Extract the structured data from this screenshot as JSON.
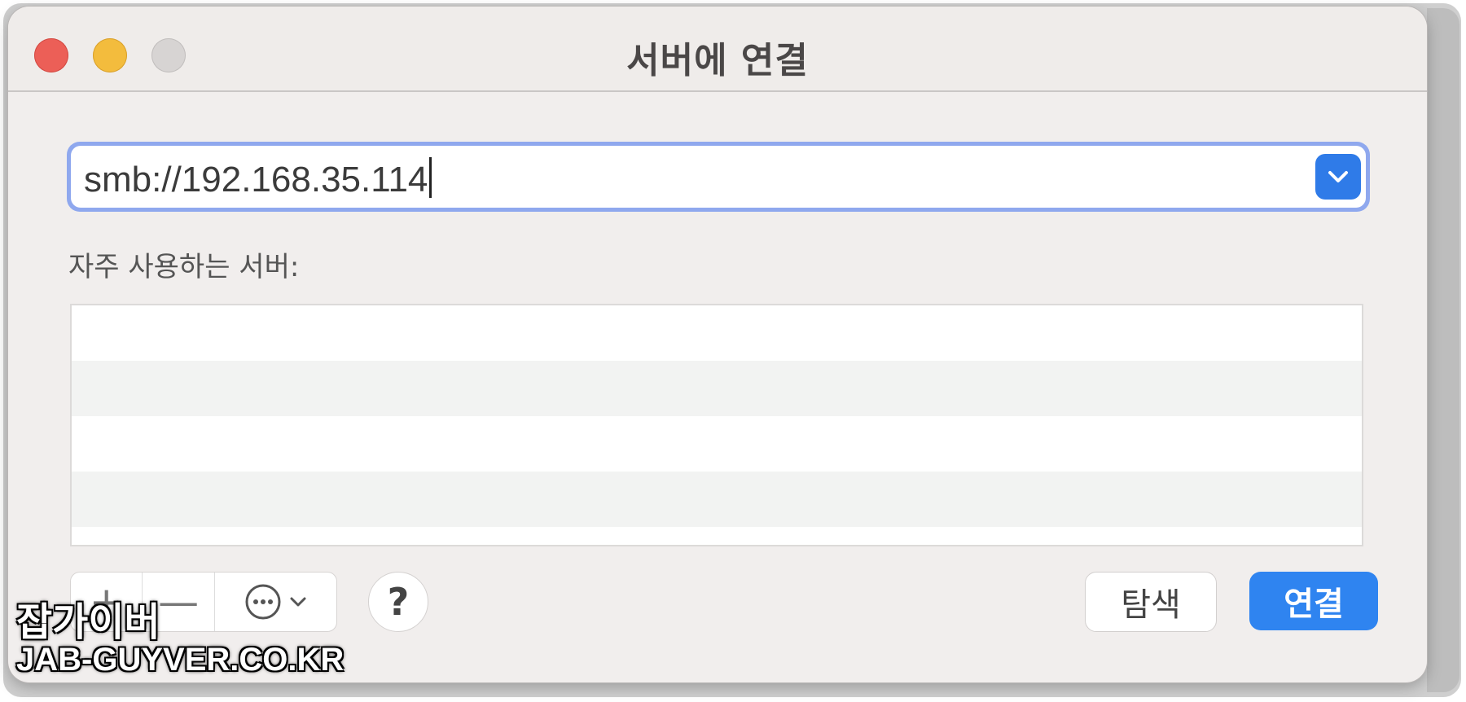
{
  "window": {
    "title": "서버에 연결"
  },
  "address": {
    "value": "smb://192.168.35.114"
  },
  "favorites": {
    "label": "자주 사용하는 서버:",
    "items": []
  },
  "toolbar": {
    "add_label": "+",
    "remove_label": "—",
    "help_label": "?"
  },
  "buttons": {
    "browse_label": "탐색",
    "connect_label": "연결"
  },
  "watermark": {
    "korean": "잡가이버",
    "url": "JAB-GUYVER.CO.KR"
  },
  "colors": {
    "accent": "#2f84f0",
    "close": "#ec5f57",
    "minimize": "#f3bc3d",
    "zoom": "#d7d4d3"
  },
  "icons": {
    "dropdown": "chevron-down-icon",
    "more": "ellipsis-circle-icon",
    "help": "question-icon"
  }
}
